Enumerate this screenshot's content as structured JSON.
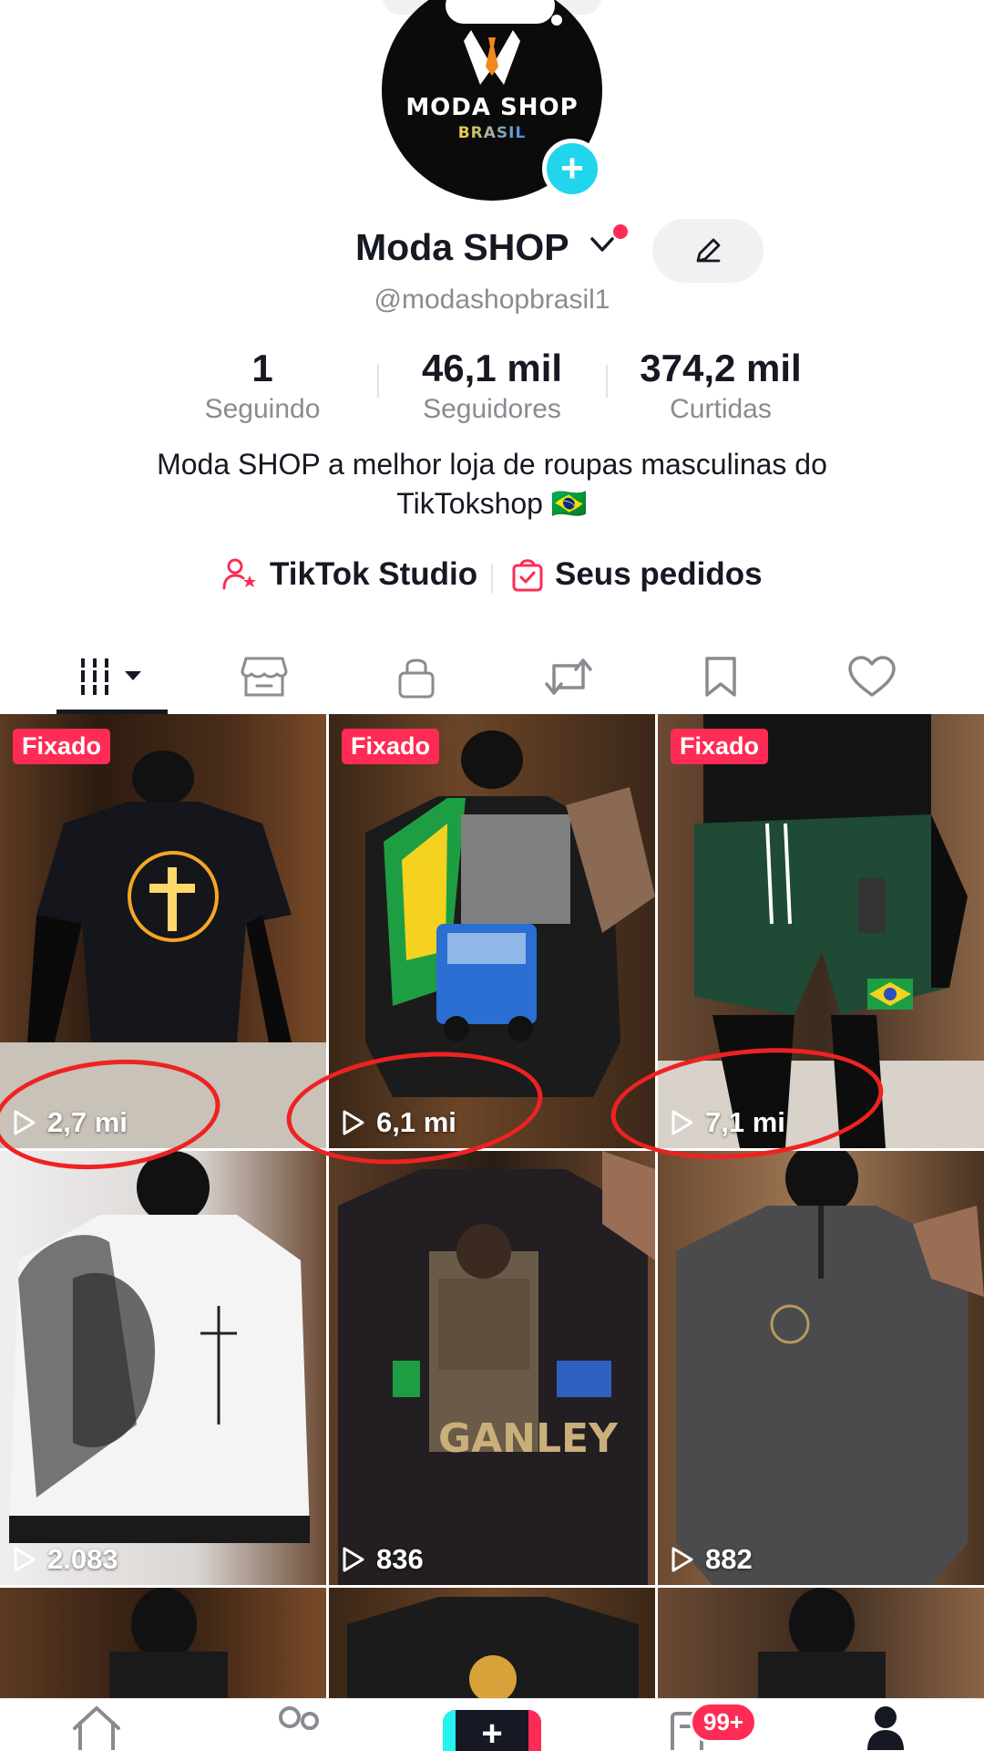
{
  "profile": {
    "logo_text": "MODA SHOP",
    "logo_sub": "BRASIL",
    "name": "Moda SHOP",
    "handle": "@modashopbrasil1",
    "bio_line1": "Moda SHOP a melhor loja de roupas masculinas do",
    "bio_line2": "TikTokshop 🇧🇷"
  },
  "stats": [
    {
      "value": "1",
      "label": "Seguindo"
    },
    {
      "value": "46,1 mil",
      "label": "Seguidores"
    },
    {
      "value": "374,2 mil",
      "label": "Curtidas"
    }
  ],
  "links": {
    "studio": "TikTok Studio",
    "orders": "Seus pedidos"
  },
  "tabs": [
    "videos-grid-icon",
    "shop-icon",
    "lock-icon",
    "repost-icon",
    "bookmark-icon",
    "heart-icon"
  ],
  "videos": [
    {
      "pinned": "Fixado",
      "views": "2,7 mi"
    },
    {
      "pinned": "Fixado",
      "views": "6,1 mi"
    },
    {
      "pinned": "Fixado",
      "views": "7,1 mi"
    },
    {
      "pinned": "",
      "views": "2.083"
    },
    {
      "pinned": "",
      "views": "836"
    },
    {
      "pinned": "",
      "views": "882"
    }
  ],
  "nav": {
    "inbox_badge": "99+"
  },
  "colors": {
    "accent": "#fe2c55",
    "cyan": "#20d5ec",
    "text": "#161823",
    "muted": "#8a8b91",
    "annotation": "#ee2222"
  }
}
